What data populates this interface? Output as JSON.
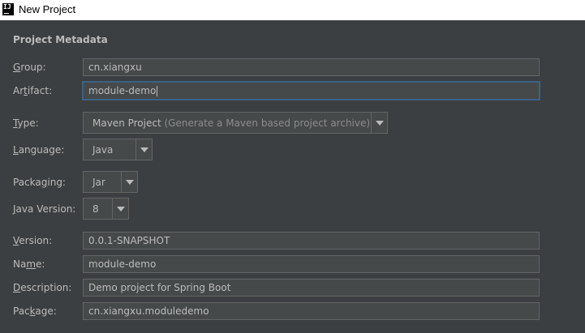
{
  "window": {
    "title": "New Project",
    "icon_text": "IJ"
  },
  "section": {
    "title": "Project Metadata"
  },
  "group": {
    "label_mn": "G",
    "label_rest": "roup:",
    "value": "cn.xiangxu"
  },
  "artifact": {
    "label_pre": "Ar",
    "label_mn": "t",
    "label_rest": "ifact:",
    "value": "module-demo"
  },
  "type": {
    "label_mn": "T",
    "label_rest": "ype:",
    "value": "Maven Project",
    "hint": "(Generate a Maven based project archive)"
  },
  "language": {
    "label_mn": "L",
    "label_rest": "anguage:",
    "value": "Java"
  },
  "packaging": {
    "label_pre": "Packa",
    "label_mn": "g",
    "label_rest": "ing:",
    "value": "Jar"
  },
  "java_version": {
    "label_mn": "J",
    "label_rest": "ava Version:",
    "value": "8"
  },
  "version": {
    "label_mn": "V",
    "label_rest": "ersion:",
    "value": "0.0.1-SNAPSHOT"
  },
  "name": {
    "label_pre": "Na",
    "label_mn": "m",
    "label_rest": "e:",
    "value": "module-demo"
  },
  "description": {
    "label_mn": "D",
    "label_rest": "escription:",
    "value": "Demo project for Spring Boot"
  },
  "package": {
    "label_pre": "Pac",
    "label_mn": "k",
    "label_rest": "age:",
    "value": "cn.xiangxu.moduledemo"
  }
}
